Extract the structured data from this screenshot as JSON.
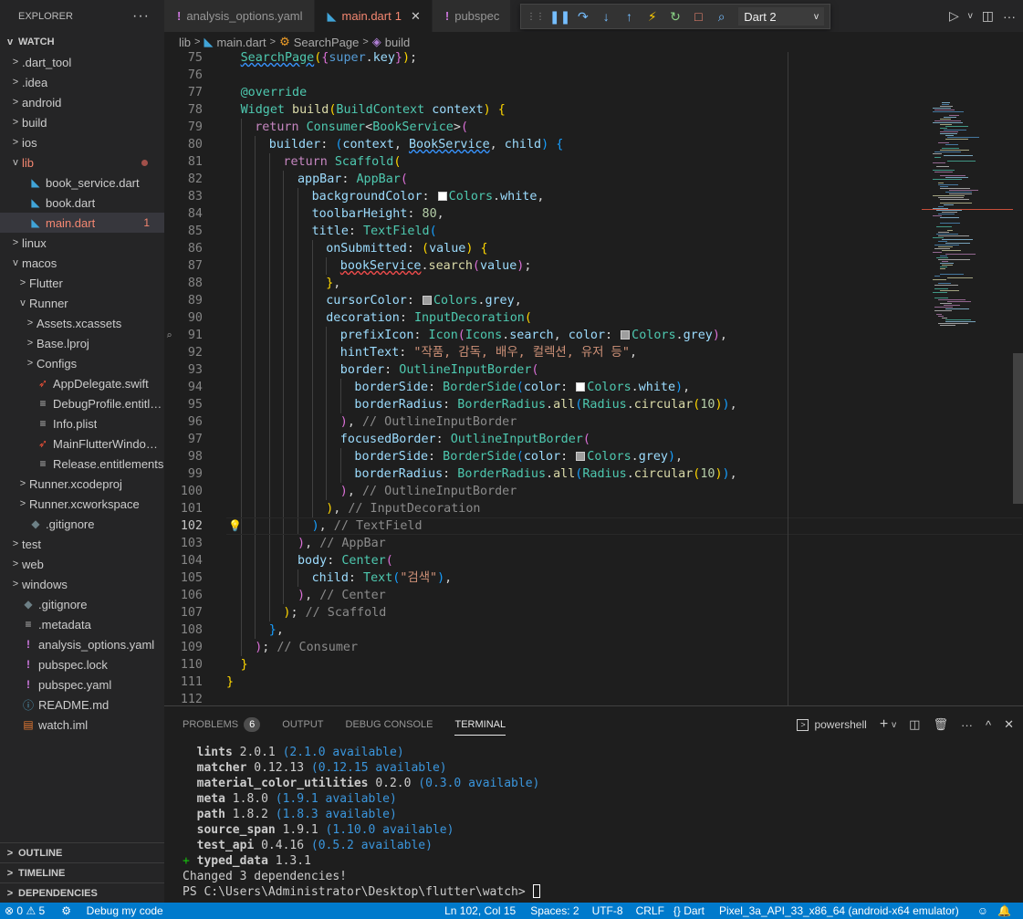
{
  "sidebar": {
    "title": "EXPLORER",
    "workspace": "WATCH",
    "items": [
      {
        "label": ".dart_tool",
        "twisty": ">",
        "icon": "",
        "indent": 0
      },
      {
        "label": ".idea",
        "twisty": ">",
        "icon": "",
        "indent": 0
      },
      {
        "label": "android",
        "twisty": ">",
        "icon": "",
        "indent": 0
      },
      {
        "label": "build",
        "twisty": ">",
        "icon": "",
        "indent": 0
      },
      {
        "label": "ios",
        "twisty": ">",
        "icon": "",
        "indent": 0
      },
      {
        "label": "lib",
        "twisty": "v",
        "icon": "",
        "indent": 0,
        "status": "modified-dot"
      },
      {
        "label": "book_service.dart",
        "twisty": "",
        "icon": "dart-icon",
        "indent": 1
      },
      {
        "label": "book.dart",
        "twisty": "",
        "icon": "dart-icon",
        "indent": 1
      },
      {
        "label": "main.dart",
        "twisty": "",
        "icon": "dart-icon",
        "indent": 1,
        "badge": "1",
        "selected": true
      },
      {
        "label": "linux",
        "twisty": ">",
        "icon": "",
        "indent": 0
      },
      {
        "label": "macos",
        "twisty": "v",
        "icon": "",
        "indent": 0
      },
      {
        "label": "Flutter",
        "twisty": ">",
        "icon": "",
        "indent": 1
      },
      {
        "label": "Runner",
        "twisty": "v",
        "icon": "",
        "indent": 1
      },
      {
        "label": "Assets.xcassets",
        "twisty": ">",
        "icon": "",
        "indent": 2
      },
      {
        "label": "Base.lproj",
        "twisty": ">",
        "icon": "",
        "indent": 2
      },
      {
        "label": "Configs",
        "twisty": ">",
        "icon": "",
        "indent": 2
      },
      {
        "label": "AppDelegate.swift",
        "twisty": "",
        "icon": "swift-icon",
        "indent": 2
      },
      {
        "label": "DebugProfile.entitle...",
        "twisty": "",
        "icon": "lines-icon",
        "indent": 2
      },
      {
        "label": "Info.plist",
        "twisty": "",
        "icon": "lines-icon",
        "indent": 2
      },
      {
        "label": "MainFlutterWindow.s...",
        "twisty": "",
        "icon": "swift-icon",
        "indent": 2
      },
      {
        "label": "Release.entitlements",
        "twisty": "",
        "icon": "lines-icon",
        "indent": 2
      },
      {
        "label": "Runner.xcodeproj",
        "twisty": ">",
        "icon": "",
        "indent": 1
      },
      {
        "label": "Runner.xcworkspace",
        "twisty": ">",
        "icon": "",
        "indent": 1
      },
      {
        "label": ".gitignore",
        "twisty": "",
        "icon": "git-icon",
        "indent": 1
      },
      {
        "label": "test",
        "twisty": ">",
        "icon": "",
        "indent": 0
      },
      {
        "label": "web",
        "twisty": ">",
        "icon": "",
        "indent": 0
      },
      {
        "label": "windows",
        "twisty": ">",
        "icon": "",
        "indent": 0
      },
      {
        "label": ".gitignore",
        "twisty": "",
        "icon": "git-icon",
        "indent": 0
      },
      {
        "label": ".metadata",
        "twisty": "",
        "icon": "lines-icon",
        "indent": 0
      },
      {
        "label": "analysis_options.yaml",
        "twisty": "",
        "icon": "bang-icon",
        "indent": 0
      },
      {
        "label": "pubspec.lock",
        "twisty": "",
        "icon": "bang-icon",
        "indent": 0
      },
      {
        "label": "pubspec.yaml",
        "twisty": "",
        "icon": "bang-icon",
        "indent": 0
      },
      {
        "label": "README.md",
        "twisty": "",
        "icon": "info-icon",
        "indent": 0
      },
      {
        "label": "watch.iml",
        "twisty": "",
        "icon": "xml-icon",
        "indent": 0
      }
    ],
    "bottom_sections": [
      "OUTLINE",
      "TIMELINE",
      "DEPENDENCIES"
    ]
  },
  "tabs": [
    {
      "label": "analysis_options.yaml",
      "icon": "!",
      "active": false
    },
    {
      "label": "main.dart",
      "icon": "dart",
      "active": true,
      "badge": "1"
    },
    {
      "label": "pubspec",
      "icon": "!",
      "active": false
    }
  ],
  "debug_toolbar": {
    "target": "Dart 2",
    "buttons": [
      "pause-icon",
      "step-over-icon",
      "step-into-icon",
      "step-out-icon",
      "hot-reload-icon",
      "restart-icon",
      "stop-icon",
      "devtools-icon"
    ]
  },
  "breadcrumb": [
    "lib",
    "main.dart",
    "SearchPage",
    "build"
  ],
  "editor": {
    "current_line": 102,
    "lines": [
      {
        "n": "75",
        "html": "<span class=\"t sqb\">SearchPage</span><span class=\"b1\">(</span><span class=\"b2\">{</span><span class=\"kb\">super</span><span class=\"p\">.</span><span class=\"v\">key</span><span class=\"b2\">}</span><span class=\"b1\">)</span><span class=\"p\">;</span>",
        "indent": 1
      },
      {
        "n": "76",
        "html": "",
        "indent": 0
      },
      {
        "n": "77",
        "html": "<span class=\"t\">@override</span>",
        "indent": 1
      },
      {
        "n": "78",
        "html": "<span class=\"t\">Widget</span> <span class=\"f\">build</span><span class=\"b1\">(</span><span class=\"t\">BuildContext</span> <span class=\"v\">context</span><span class=\"b1\">)</span> <span class=\"b1\">{</span>",
        "indent": 1
      },
      {
        "n": "79",
        "html": "<span class=\"k\">return</span> <span class=\"t\">Consumer</span><span class=\"p\">&lt;</span><span class=\"t\">BookService</span><span class=\"p\">&gt;</span><span class=\"b2\">(</span>",
        "indent": 2
      },
      {
        "n": "80",
        "html": "<span class=\"v\">builder</span><span class=\"p\">: </span><span class=\"b3\">(</span><span class=\"v\">context</span><span class=\"p\">, </span><span class=\"v sqb\">BookService</span><span class=\"p\">, </span><span class=\"v\">child</span><span class=\"b3\">)</span> <span class=\"b3\">{</span>",
        "indent": 3
      },
      {
        "n": "81",
        "html": "<span class=\"k\">return</span> <span class=\"t\">Scaffold</span><span class=\"b1\">(</span>",
        "indent": 4
      },
      {
        "n": "82",
        "html": "<span class=\"v\">appBar</span><span class=\"p\">: </span><span class=\"t\">AppBar</span><span class=\"b2\">(</span>",
        "indent": 5
      },
      {
        "n": "83",
        "html": "<span class=\"v\">backgroundColor</span><span class=\"p\">: </span><span class=\"sw\" style=\"background:#ffffff\"></span><span class=\"t\">Colors</span><span class=\"p\">.</span><span class=\"v\">white</span><span class=\"p\">,</span>",
        "indent": 6
      },
      {
        "n": "84",
        "html": "<span class=\"v\">toolbarHeight</span><span class=\"p\">: </span><span class=\"n\">80</span><span class=\"p\">,</span>",
        "indent": 6
      },
      {
        "n": "85",
        "html": "<span class=\"v\">title</span><span class=\"p\">: </span><span class=\"t\">TextField</span><span class=\"b3\">(</span>",
        "indent": 6
      },
      {
        "n": "86",
        "html": "<span class=\"v\">onSubmitted</span><span class=\"p\">: </span><span class=\"b1\">(</span><span class=\"v\">value</span><span class=\"b1\">)</span> <span class=\"b1\">{</span>",
        "indent": 7
      },
      {
        "n": "87",
        "html": "<span class=\"v sq\">bookService</span><span class=\"p\">.</span><span class=\"f\">search</span><span class=\"b2\">(</span><span class=\"v\">value</span><span class=\"b2\">)</span><span class=\"p\">;</span>",
        "indent": 8
      },
      {
        "n": "88",
        "html": "<span class=\"b1\">}</span><span class=\"p\">,</span>",
        "indent": 7
      },
      {
        "n": "89",
        "html": "<span class=\"v\">cursorColor</span><span class=\"p\">: </span><span class=\"sw\" style=\"background:#9e9e9e\"></span><span class=\"t\">Colors</span><span class=\"p\">.</span><span class=\"v\">grey</span><span class=\"p\">,</span>",
        "indent": 7
      },
      {
        "n": "90",
        "html": "<span class=\"v\">decoration</span><span class=\"p\">: </span><span class=\"t\">InputDecoration</span><span class=\"b1\">(</span>",
        "indent": 7
      },
      {
        "n": "91",
        "html": "<span class=\"v\">prefixIcon</span><span class=\"p\">: </span><span class=\"t\">Icon</span><span class=\"b2\">(</span><span class=\"t\">Icons</span><span class=\"p\">.</span><span class=\"v\">search</span><span class=\"p\">, </span><span class=\"v\">color</span><span class=\"p\">: </span><span class=\"sw\" style=\"background:#9e9e9e\"></span><span class=\"t\">Colors</span><span class=\"p\">.</span><span class=\"v\">grey</span><span class=\"b2\">)</span><span class=\"p\">,</span>",
        "indent": 8,
        "glyph": true
      },
      {
        "n": "92",
        "html": "<span class=\"v\">hintText</span><span class=\"p\">: </span><span class=\"s\">\"작품, 감독, 배우, 컬렉션, 유저 등\"</span><span class=\"p\">,</span>",
        "indent": 8
      },
      {
        "n": "93",
        "html": "<span class=\"v\">border</span><span class=\"p\">: </span><span class=\"t\">OutlineInputBorder</span><span class=\"b2\">(</span>",
        "indent": 8
      },
      {
        "n": "94",
        "html": "<span class=\"v\">borderSide</span><span class=\"p\">: </span><span class=\"t\">BorderSide</span><span class=\"b3\">(</span><span class=\"v\">color</span><span class=\"p\">: </span><span class=\"sw\" style=\"background:#ffffff\"></span><span class=\"t\">Colors</span><span class=\"p\">.</span><span class=\"v\">white</span><span class=\"b3\">)</span><span class=\"p\">,</span>",
        "indent": 9
      },
      {
        "n": "95",
        "html": "<span class=\"v\">borderRadius</span><span class=\"p\">: </span><span class=\"t\">BorderRadius</span><span class=\"p\">.</span><span class=\"f\">all</span><span class=\"b3\">(</span><span class=\"t\">Radius</span><span class=\"p\">.</span><span class=\"f\">circular</span><span class=\"b1\">(</span><span class=\"n\">10</span><span class=\"b1\">)</span><span class=\"b3\">)</span><span class=\"p\">,</span>",
        "indent": 9
      },
      {
        "n": "96",
        "html": "<span class=\"b2\">)</span><span class=\"p\">, </span><span class=\"cg\">// OutlineInputBorder</span>",
        "indent": 8
      },
      {
        "n": "97",
        "html": "<span class=\"v\">focusedBorder</span><span class=\"p\">: </span><span class=\"t\">OutlineInputBorder</span><span class=\"b2\">(</span>",
        "indent": 8
      },
      {
        "n": "98",
        "html": "<span class=\"v\">borderSide</span><span class=\"p\">: </span><span class=\"t\">BorderSide</span><span class=\"b3\">(</span><span class=\"v\">color</span><span class=\"p\">: </span><span class=\"sw\" style=\"background:#9e9e9e\"></span><span class=\"t\">Colors</span><span class=\"p\">.</span><span class=\"v\">grey</span><span class=\"b3\">)</span><span class=\"p\">,</span>",
        "indent": 9
      },
      {
        "n": "99",
        "html": "<span class=\"v\">borderRadius</span><span class=\"p\">: </span><span class=\"t\">BorderRadius</span><span class=\"p\">.</span><span class=\"f\">all</span><span class=\"b3\">(</span><span class=\"t\">Radius</span><span class=\"p\">.</span><span class=\"f\">circular</span><span class=\"b1\">(</span><span class=\"n\">10</span><span class=\"b1\">)</span><span class=\"b3\">)</span><span class=\"p\">,</span>",
        "indent": 9
      },
      {
        "n": "100",
        "html": "<span class=\"b2\">)</span><span class=\"p\">, </span><span class=\"cg\">// OutlineInputBorder</span>",
        "indent": 8
      },
      {
        "n": "101",
        "html": "<span class=\"b1\">)</span><span class=\"p\">, </span><span class=\"cg\">// InputDecoration</span>",
        "indent": 7
      },
      {
        "n": "102",
        "html": "<span class=\"b3\">)</span><span class=\"p\">, </span><span class=\"cg\">// TextField</span>",
        "indent": 6,
        "bulb": true
      },
      {
        "n": "103",
        "html": "<span class=\"b2\">)</span><span class=\"p\">, </span><span class=\"cg\">// AppBar</span>",
        "indent": 5
      },
      {
        "n": "104",
        "html": "<span class=\"v\">body</span><span class=\"p\">: </span><span class=\"t\">Center</span><span class=\"b2\">(</span>",
        "indent": 5
      },
      {
        "n": "105",
        "html": "<span class=\"v\">child</span><span class=\"p\">: </span><span class=\"t\">Text</span><span class=\"b3\">(</span><span class=\"s\">\"검색\"</span><span class=\"b3\">)</span><span class=\"p\">,</span>",
        "indent": 6
      },
      {
        "n": "106",
        "html": "<span class=\"b2\">)</span><span class=\"p\">, </span><span class=\"cg\">// Center</span>",
        "indent": 5
      },
      {
        "n": "107",
        "html": "<span class=\"b1\">)</span><span class=\"p\">; </span><span class=\"cg\">// Scaffold</span>",
        "indent": 4
      },
      {
        "n": "108",
        "html": "<span class=\"b3\">}</span><span class=\"p\">,</span>",
        "indent": 3
      },
      {
        "n": "109",
        "html": "<span class=\"b2\">)</span><span class=\"p\">; </span><span class=\"cg\">// Consumer</span>",
        "indent": 2
      },
      {
        "n": "110",
        "html": "<span class=\"b1\">}</span>",
        "indent": 1
      },
      {
        "n": "111",
        "html": "<span class=\"b1\">}</span>",
        "indent": 0
      },
      {
        "n": "112",
        "html": "",
        "indent": 0
      }
    ]
  },
  "panel": {
    "tabs": [
      {
        "label": "PROBLEMS",
        "count": "6",
        "active": false
      },
      {
        "label": "OUTPUT",
        "active": false
      },
      {
        "label": "DEBUG CONSOLE",
        "active": false
      },
      {
        "label": "TERMINAL",
        "active": true
      }
    ],
    "shell": "powershell",
    "terminal_lines": [
      {
        "prefix": "  ",
        "name": "lints",
        "ver": "2.0.1",
        "avail": "(2.1.0 available)"
      },
      {
        "prefix": "  ",
        "name": "matcher",
        "ver": "0.12.13",
        "avail": "(0.12.15 available)"
      },
      {
        "prefix": "  ",
        "name": "material_color_utilities",
        "ver": "0.2.0",
        "avail": "(0.3.0 available)"
      },
      {
        "prefix": "  ",
        "name": "meta",
        "ver": "1.8.0",
        "avail": "(1.9.1 available)"
      },
      {
        "prefix": "  ",
        "name": "path",
        "ver": "1.8.2",
        "avail": "(1.8.3 available)"
      },
      {
        "prefix": "  ",
        "name": "source_span",
        "ver": "1.9.1",
        "avail": "(1.10.0 available)"
      },
      {
        "prefix": "  ",
        "name": "test_api",
        "ver": "0.4.16",
        "avail": "(0.5.2 available)"
      },
      {
        "prefix": "+ ",
        "name": "typed_data",
        "ver": "1.3.1",
        "avail": ""
      }
    ],
    "summary": "Changed 3 dependencies!",
    "prompt": "PS C:\\Users\\Administrator\\Desktop\\flutter\\watch> "
  },
  "statusbar": {
    "errors": "0",
    "warnings": "5",
    "debug_label": "Debug my code",
    "position": "Ln 102, Col 15",
    "spaces": "Spaces: 2",
    "encoding": "UTF-8",
    "eol": "CRLF",
    "language": "Dart",
    "device": "Pixel_3a_API_33_x86_64 (android-x64 emulator)"
  }
}
